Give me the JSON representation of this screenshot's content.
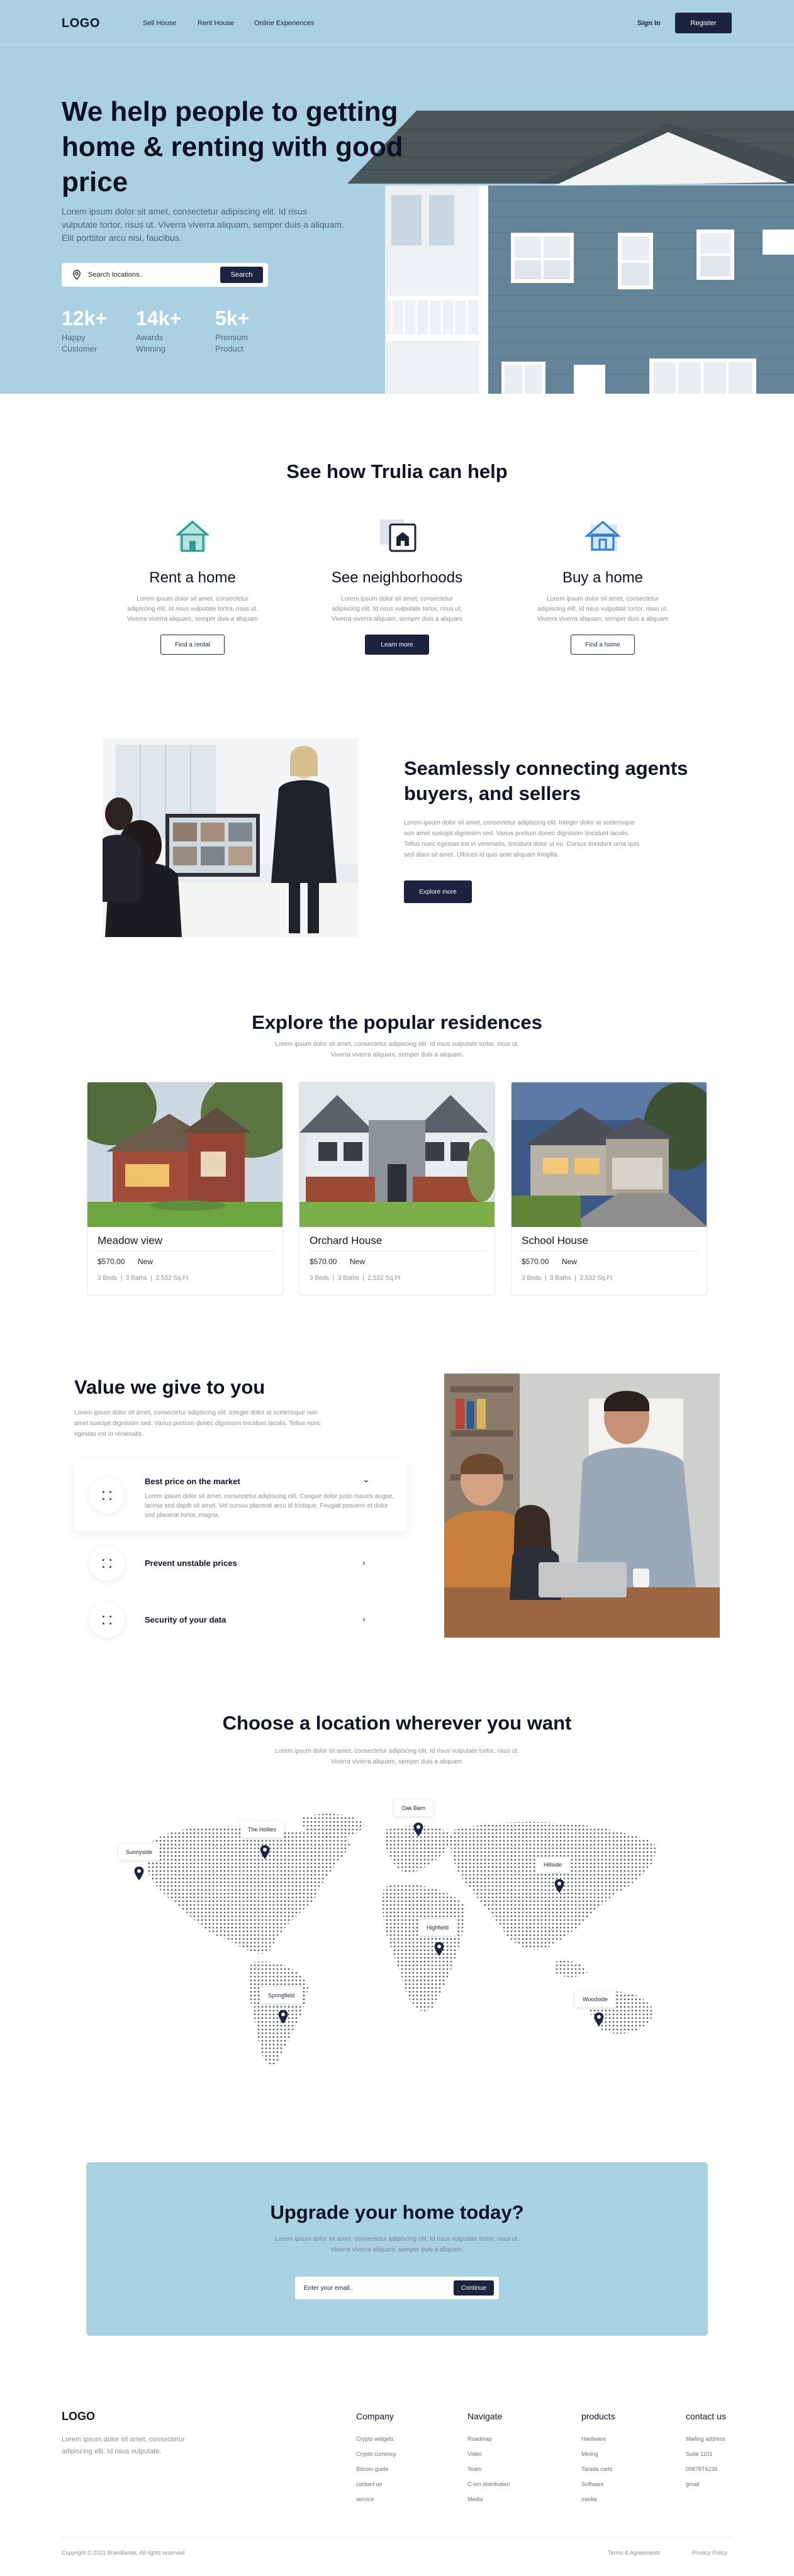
{
  "nav": {
    "logo": "LOGO",
    "links": [
      "Sell House",
      "Rent House",
      "Online Experiences"
    ],
    "sign_in": "Sign In",
    "register": "Register"
  },
  "hero": {
    "title": "We help people to getting home & renting with good price",
    "text": "Lorem ipsum dolor sit amet, consectetur adipiscing elit. Id risus vulputate tortor, risus ut. Viverra viverra aliquam, semper duis a aliquam. Elit porttitor arcu nisi, faucibus.",
    "search_placeholder": "Search locations..",
    "search_button": "Search",
    "stats": [
      {
        "number": "12k+",
        "label_1": "Happy",
        "label_2": "Customer"
      },
      {
        "number": "14k+",
        "label_1": "Awards",
        "label_2": "Winning"
      },
      {
        "number": "5k+",
        "label_1": "Premium",
        "label_2": "Product"
      }
    ]
  },
  "help": {
    "title": "See how Trulia can help",
    "items": [
      {
        "title": "Rent a home",
        "text": "Lorem ipsum dolor sit amet, consectetur adipiscing elit. Id risus vulputate tortor, risus ut. Viverra viverra aliquam, semper duis a aliquam",
        "button": "Find a rental"
      },
      {
        "title": "See neighborhoods",
        "text": "Lorem ipsum dolor sit amet, consectetur adipiscing elit. Id risus vulputate tortor, risus ut. Viverra viverra aliquam, semper duis a aliquam",
        "button": "Learn more"
      },
      {
        "title": "Buy a home",
        "text": "Lorem ipsum dolor sit amet, consectetur adipiscing elit. Id risus vulputate tortor, risus ut. Viverra viverra aliquam, semper duis a aliquam",
        "button": "Find a home"
      }
    ]
  },
  "agents": {
    "title": "Seamlessly connecting agents buyers, and sellers",
    "text": "Lorem ipsum dolor sit amet, consectetur adipiscing elit. Integer dolor at scelerisque non amet suscipit dignissim sed. Varius pretium donec dignissim tincidunt iaculis. Tellus nunc egestas est in venenatis, tincidunt dolor ut eu. Cursus tincidunt urna quis sed diam sit amet. Ultrices id quis ante aliquam fringilla.",
    "button": "Explore more"
  },
  "residences": {
    "title": "Explore the popular residences",
    "subtitle": "Lorem ipsum dolor sit amet, consectetur adipiscing elit. Id risus vulputate tortor, risus ut. Viverra viverra aliquam, semper duis a aliquam.",
    "cards": [
      {
        "name": "Meadow view",
        "price": "$570.00",
        "badge": "New",
        "beds": "3 Beds",
        "baths": "3 Baths",
        "area": "2,532 Sq.Ft"
      },
      {
        "name": "Orchard House",
        "price": "$570.00",
        "badge": "New",
        "beds": "3 Beds",
        "baths": "3 Baths",
        "area": "2,532 Sq.Ft"
      },
      {
        "name": "School House",
        "price": "$570.00",
        "badge": "New",
        "beds": "3 Beds",
        "baths": "3 Baths",
        "area": "2,532 Sq.Ft"
      }
    ]
  },
  "value": {
    "title": "Value we give to you",
    "text": "Lorem ipsum dolor sit amet, consectetur adipiscing elit. Integer dolor at scelerisque non amet suscipit dignissim sed. Varius pretium donec dignissim tincidunt iaculis. Tellus nunc egestas est in venenatis.",
    "items": [
      {
        "title": "Best price on the market",
        "text": "Lorem ipsum dolor sit amet, consectetur adipiscing elit. Congue dolor justo mauris augue, lacinia sed dapib sit amet. Vel cursus placerat arcu id tristique. Feugiat posuere et dolor sed placerat tortor, magna."
      },
      {
        "title": "Prevent unstable prices"
      },
      {
        "title": "Security of your data"
      }
    ]
  },
  "locations": {
    "title": "Choose a location wherever you want",
    "subtitle": "Lorem ipsum dolor sit amet, consectetur adipiscing elit. Id risus vulputate tortor, risus ut. Viverra viverra aliquam, semper duis a aliquam.",
    "pins": [
      "Sunnyside",
      "The Hollies",
      "Oak Barn",
      "Hillside",
      "Highfield",
      "Springfield",
      "Woodside"
    ]
  },
  "cta": {
    "title": "Upgrade your home today?",
    "text": "Lorem ipsum dolor sit amet, consectetur adipiscing elit. Id risus vulputate tortor, risus ut. Viverra viverra aliquam, semper duis a aliquam.",
    "placeholder": "Enter your email..",
    "button": "Continue"
  },
  "footer": {
    "logo": "LOGO",
    "text": "Lorem ipsum dolor sit amet, consectetur adipiscing elit. Id risus vulputate.",
    "columns": [
      {
        "title": "Company",
        "links": [
          "Crypto widgets",
          "Crypto currency",
          "Bitcoin guide",
          "contact us",
          "service"
        ]
      },
      {
        "title": "Navigate",
        "links": [
          "Roadmap",
          "Video",
          "Team",
          "C-ion distribution",
          "Media"
        ]
      },
      {
        "title": "products",
        "links": [
          "Hardware",
          "Mining",
          "Tarada carts",
          "Software",
          "media"
        ]
      },
      {
        "title": "contact us",
        "links": [
          "Mailing address",
          "Suite 1101",
          "09878T6236",
          "gmail"
        ]
      }
    ],
    "copyright": "Copyright © 2021 BrainBankk. All rights reserved",
    "terms": "Terms & Agreements",
    "privacy": "Privacy Policy"
  },
  "colors": {
    "accent": "#1c2340",
    "hero_bg": "#aad1e2",
    "cta_bg": "#a9d2e3",
    "icon_teal": "#3aa8a0",
    "icon_blue": "#2a7fd4"
  }
}
